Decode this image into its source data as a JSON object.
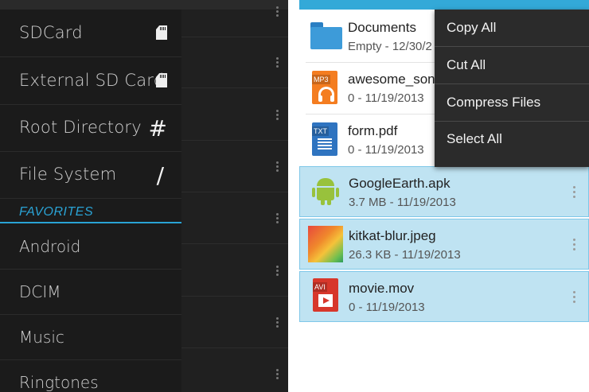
{
  "drawer": {
    "storage": [
      {
        "label": "SDCard",
        "icon": "sd-card-icon"
      },
      {
        "label": "External SD Card",
        "icon": "sd-card-icon"
      },
      {
        "label": "Root Directory",
        "icon_glyph": "#"
      },
      {
        "label": "File System",
        "icon_glyph": "/"
      }
    ],
    "favorites_header": "FAVORITES",
    "favorites": [
      "Android",
      "DCIM",
      "Music",
      "Ringtones"
    ]
  },
  "files": [
    {
      "name": "Documents",
      "meta": "Empty - 12/30/2",
      "type": "folder",
      "selected": false
    },
    {
      "name": "awesome_son",
      "meta": "0 - 11/19/2013",
      "type": "MP3",
      "selected": false
    },
    {
      "name": "form.pdf",
      "meta": "0 - 11/19/2013",
      "type": "TXT",
      "selected": false
    },
    {
      "name": "GoogleEarth.apk",
      "meta": "3.7 MB - 11/19/2013",
      "type": "apk",
      "selected": true
    },
    {
      "name": "kitkat-blur.jpeg",
      "meta": "26.3 KB - 11/19/2013",
      "type": "image",
      "selected": true
    },
    {
      "name": "movie.mov",
      "meta": "0 - 11/19/2013",
      "type": "AVI",
      "selected": true
    }
  ],
  "menu": [
    "Copy All",
    "Cut All",
    "Compress Files",
    "Select All"
  ],
  "colors": {
    "accent": "#2aa3d5",
    "selection": "#bfe3f2",
    "drawer_bg": "#1b1b1b"
  }
}
